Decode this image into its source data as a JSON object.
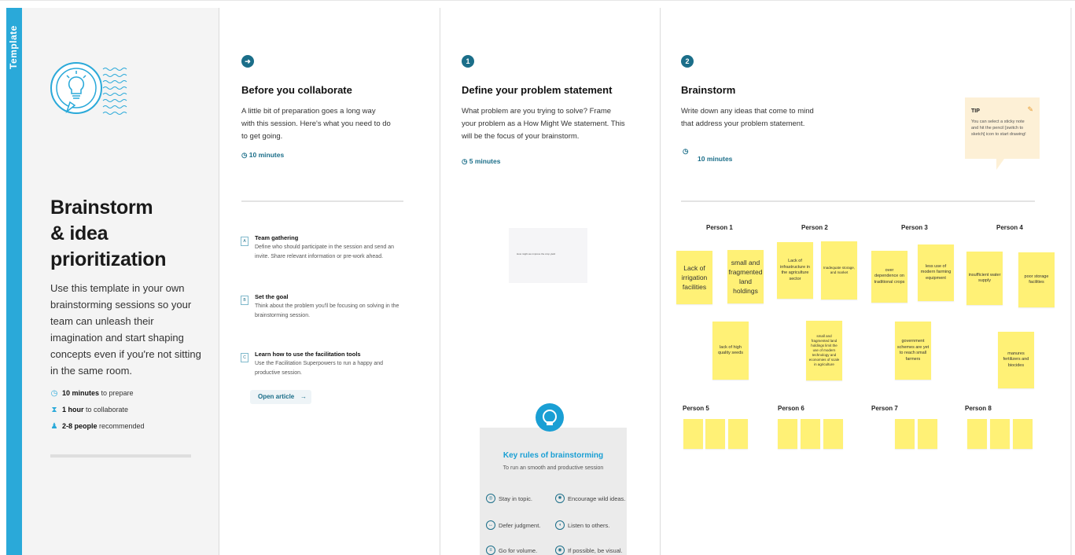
{
  "template_label": "Template",
  "intro": {
    "title_line1": "Brainstorm",
    "title_line2": "& idea prioritization",
    "description": "Use this template in your own brainstorming sessions so your team can unleash their imagination and start shaping concepts even if you're not sitting in the same room.",
    "stats": [
      {
        "icon": "stopwatch-icon",
        "bold": "10 minutes",
        "text": " to prepare"
      },
      {
        "icon": "hourglass-icon",
        "bold": "1 hour",
        "text": " to collaborate"
      },
      {
        "icon": "person-icon",
        "bold": "2-8 people",
        "text": " recommended"
      }
    ]
  },
  "collaborate": {
    "badge": "➜",
    "title": "Before you collaborate",
    "text": "A little bit of preparation goes a long way with this session. Here's what you need to do to get going.",
    "timer": "10 minutes",
    "steps": [
      {
        "letter": "A",
        "title": "Team gathering",
        "text": "Define who should participate in the session and send an invite. Share relevant information or pre-work ahead."
      },
      {
        "letter": "B",
        "title": "Set the goal",
        "text": "Think about the problem you'll be focusing on solving in the brainstorming session."
      },
      {
        "letter": "C",
        "title": "Learn how to use the facilitation tools",
        "text": "Use the Facilitation Superpowers to run a happy and productive session."
      }
    ],
    "open_article": "Open article",
    "arrow": "→"
  },
  "define": {
    "badge": "1",
    "title": "Define your problem statement",
    "text": "What problem are you trying to solve? Frame your problem as a How Might We statement. This will be the focus of your brainstorm.",
    "timer": "5 minutes",
    "card_text": "How might we improve the crop yield",
    "rules_title": "Key rules of brainstorming",
    "rules_sub": "To run an smooth and productive session",
    "rules": [
      {
        "icon": "focus-icon",
        "text": "Stay in topic."
      },
      {
        "icon": "idea-icon",
        "text": "Encourage wild ideas."
      },
      {
        "icon": "defer-icon",
        "text": "Defer judgment."
      },
      {
        "icon": "ear-icon",
        "text": "Listen to others."
      },
      {
        "icon": "volume-icon",
        "text": "Go for volume."
      },
      {
        "icon": "visual-icon",
        "text": "If possible, be visual."
      }
    ]
  },
  "brainstorm": {
    "badge": "2",
    "title": "Brainstorm",
    "text": "Write down any ideas that come to mind that address your problem statement.",
    "timer": "10 minutes",
    "tip_title": "TIP",
    "tip_text": "You can select a sticky note and hit the pencil [switch to sketch] icon to start drawing!",
    "persons": [
      "Person 1",
      "Person 2",
      "Person 3",
      "Person 4",
      "Person 5",
      "Person 6",
      "Person 7",
      "Person 8"
    ],
    "notes": [
      "Lack of irrigation facilities",
      "small and fragmented land holdings",
      "Lack of infrastructure in the agriculture sector",
      "Inadequate storage, and market",
      "over dependence on traditional crops",
      "less use of modern farming equipment",
      "insufficient water supply",
      "poor storage facilities",
      "lack of high quality seeds",
      "small and fragmented land holdings limit the use of modern technology and economies of scale in agriculture",
      "government schemes are yet to reach small farmers",
      "manures fertilizers and biocides"
    ]
  },
  "colors": {
    "accent": "#2aa9d9",
    "badge": "#1b6e89",
    "sticky": "#fff176",
    "tip": "#fdf0d6"
  }
}
